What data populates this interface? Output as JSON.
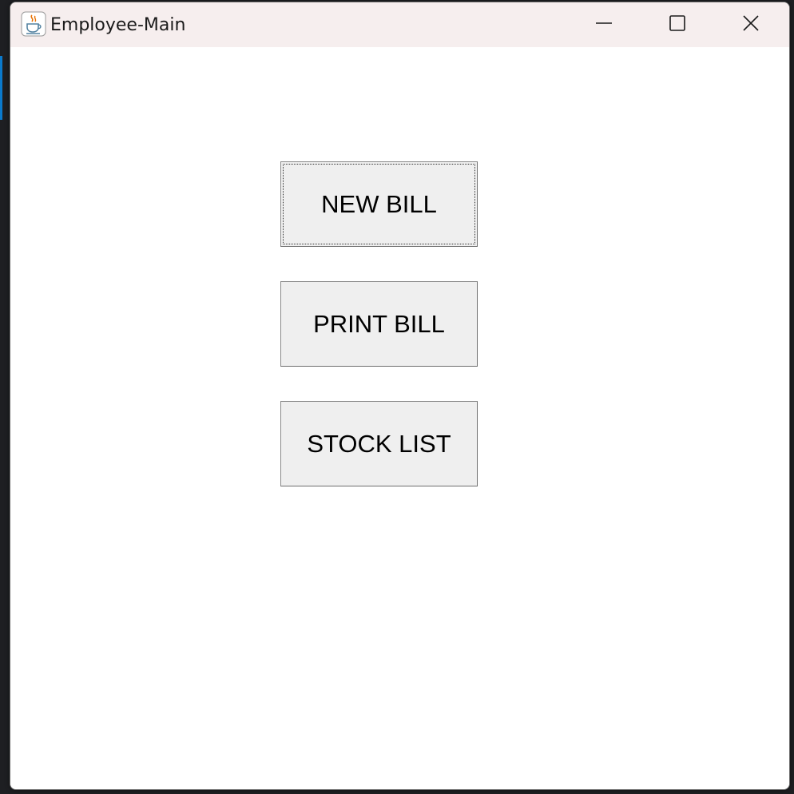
{
  "window": {
    "title": "Employee-Main",
    "app_icon": "java-coffee-icon"
  },
  "title_controls": {
    "minimize_icon": "minimize-icon",
    "maximize_icon": "maximize-icon",
    "close_icon": "close-icon"
  },
  "buttons": {
    "new_bill": "NEW BILL",
    "print_bill": "PRINT BILL",
    "stock_list": "STOCK LIST"
  },
  "colors": {
    "titlebar": "#f6eeee",
    "button_face": "#efefef",
    "window_bg": "#ffffff"
  }
}
